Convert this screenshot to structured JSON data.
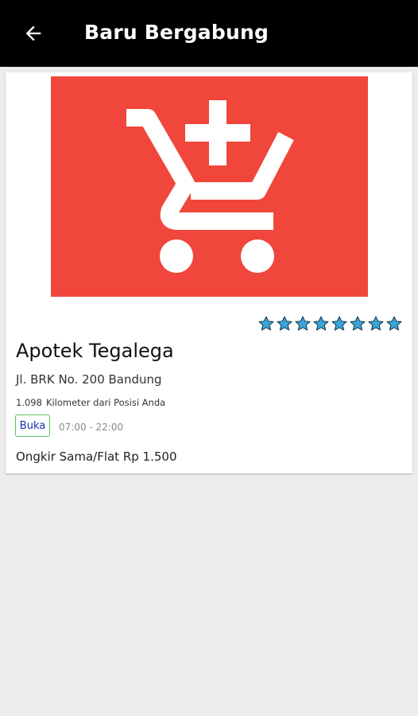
{
  "appbar": {
    "title": "Baru Bergabung",
    "back_icon": "arrow-left-icon"
  },
  "store": {
    "logo_icon": "cart-plus-icon",
    "logo_color": "#f1463b",
    "star_color": "#3aa6d8",
    "rating_stars": 8,
    "name": "Apotek Tegalega",
    "address": "Jl. BRK No. 200 Bandung",
    "distance_value": "1.098",
    "distance_label": "Kilometer dari Posisi Anda",
    "status": "Buka",
    "hours": "07:00 - 22:00",
    "shipping": "Ongkir Sama/Flat Rp 1.500"
  }
}
